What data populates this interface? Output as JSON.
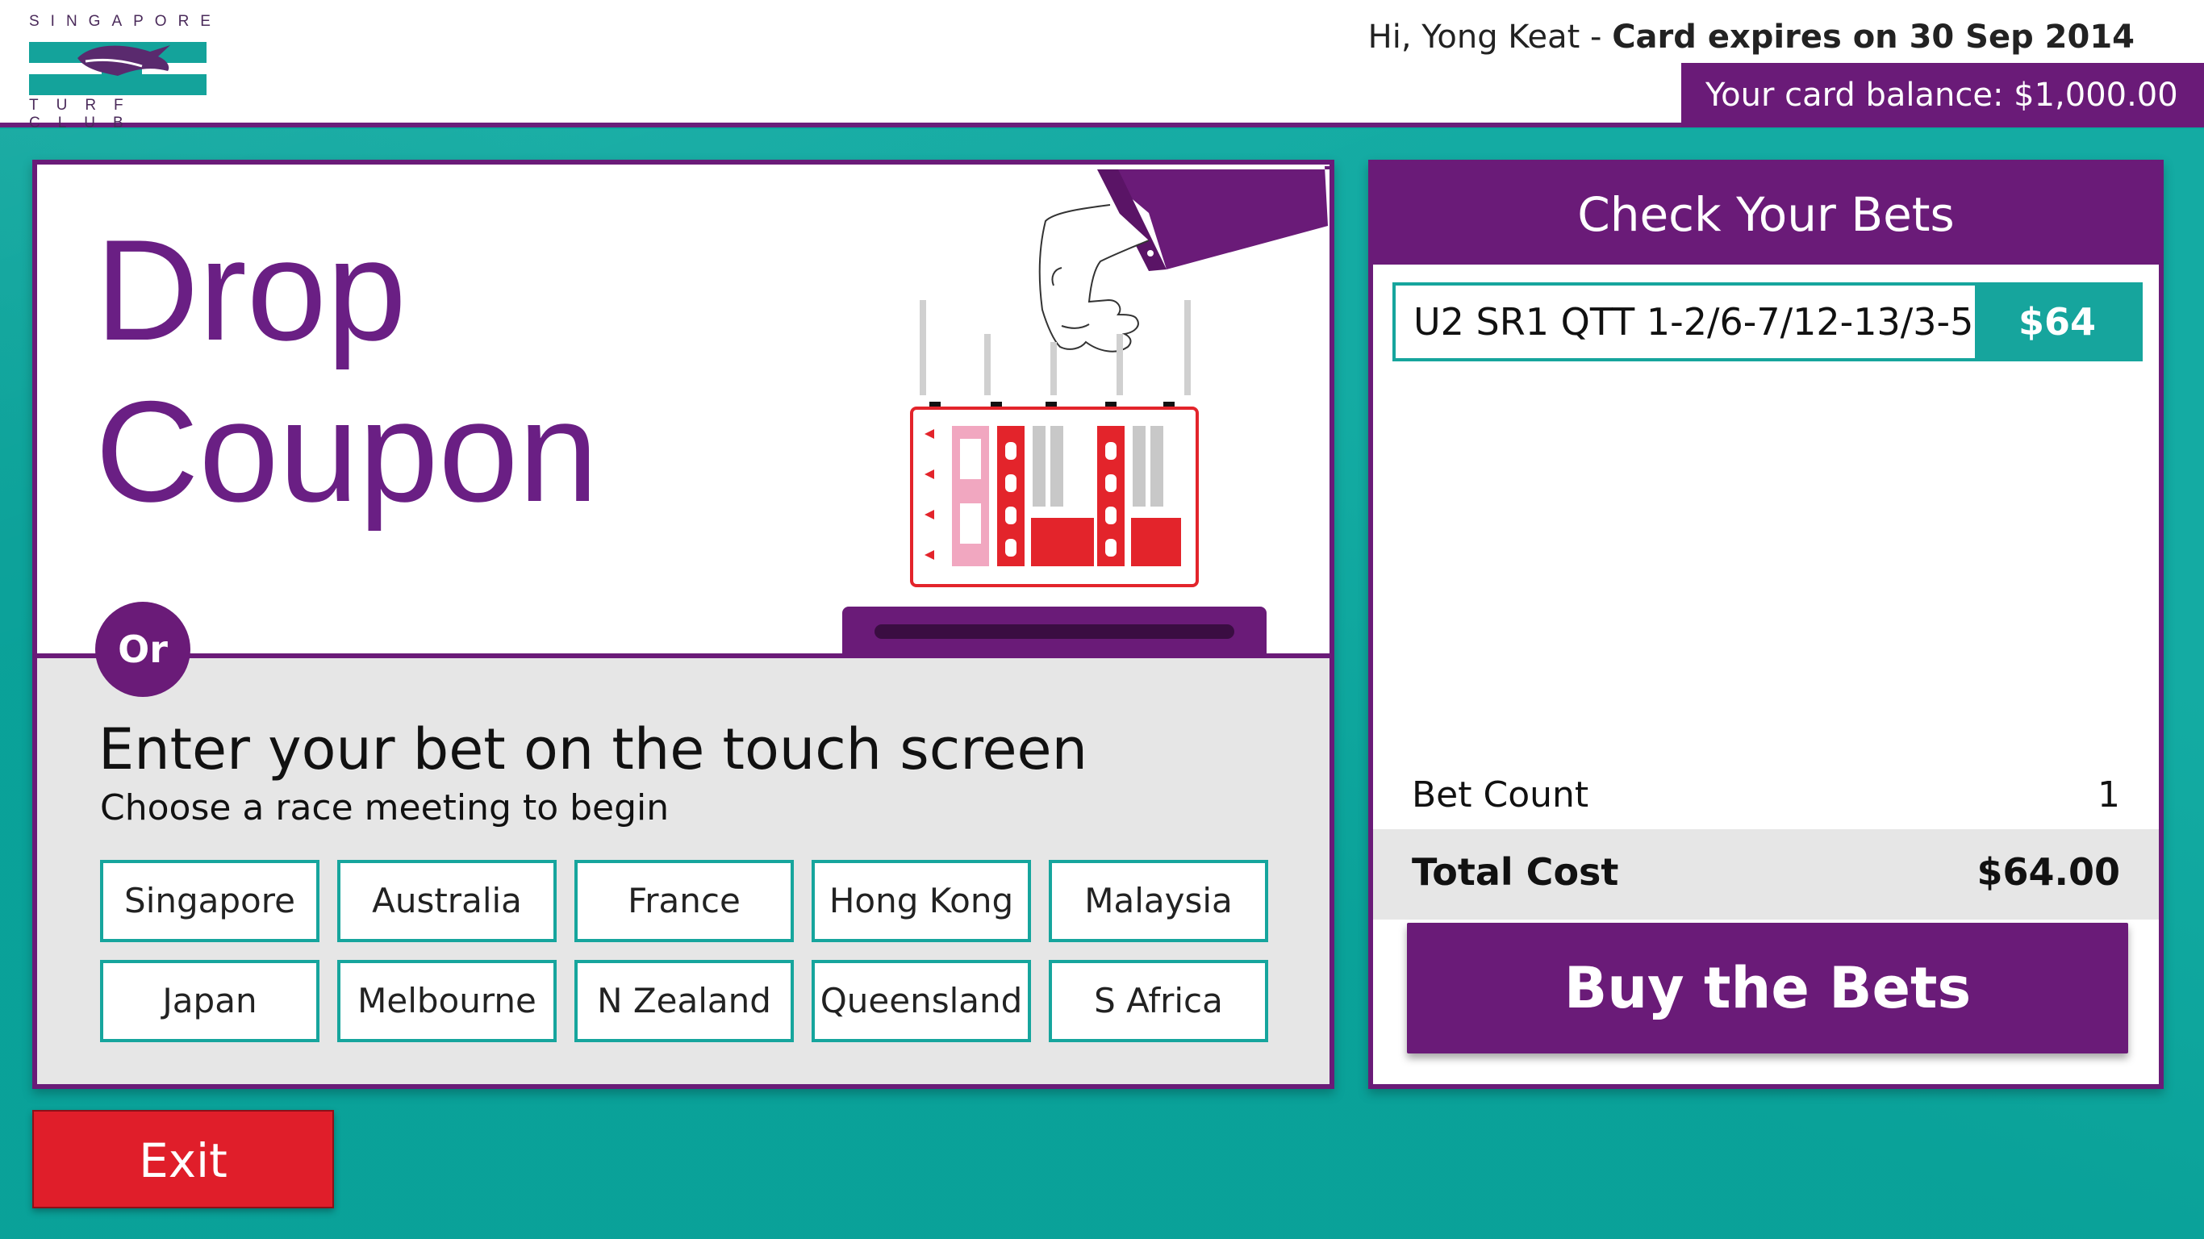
{
  "header": {
    "logo_top": "SINGAPORE",
    "logo_bottom": "TURF CLUB",
    "greeting_name": "Hi, Yong Keat - ",
    "greeting_expiry": "Card expires on 30 Sep 2014",
    "balance": "Your card balance: $1,000.00"
  },
  "left": {
    "drop_line1": "Drop",
    "drop_line2": "Coupon",
    "or_label": "Or",
    "enter_title": "Enter your bet on the touch screen",
    "enter_sub": "Choose a race meeting to begin",
    "meetings": [
      "Singapore",
      "Australia",
      "France",
      "Hong Kong",
      "Malaysia",
      "Japan",
      "Melbourne",
      "N Zealand",
      "Queensland",
      "S Africa"
    ]
  },
  "right": {
    "title": "Check Your Bets",
    "bets": [
      {
        "text": "U2 SR1 QTT 1-2/6-7/12-13/3-5",
        "amount": "$64"
      }
    ],
    "bet_count_label": "Bet Count",
    "bet_count_value": "1",
    "total_label": "Total Cost",
    "total_value": "$64.00",
    "buy_label": "Buy the Bets"
  },
  "exit_label": "Exit",
  "colors": {
    "brand_purple": "#6a1b78",
    "teal": "#16a59d",
    "exit_red": "#e01e2a"
  },
  "icons": {
    "hand": "hand-dropping-coupon-icon",
    "coupon": "betting-coupon-icon",
    "slot": "coupon-slot-icon"
  }
}
